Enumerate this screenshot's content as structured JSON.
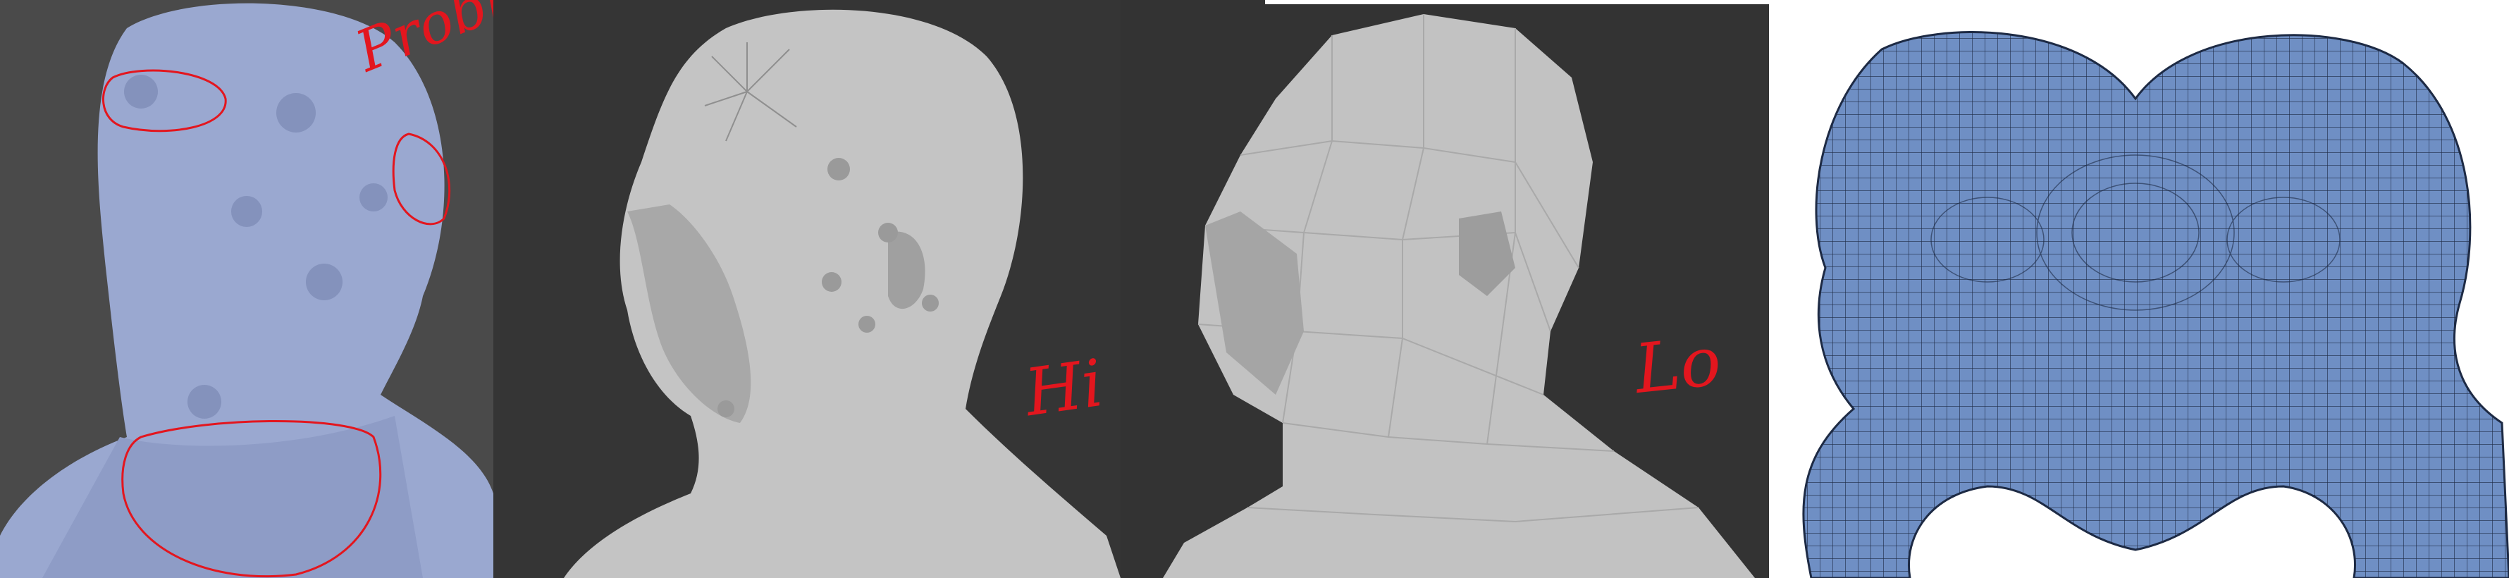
{
  "annotations": {
    "problem": "Problem",
    "hi": "Hi",
    "lo": "Lo"
  },
  "panels": {
    "baked": {
      "kind": "baked-normal-map-preview",
      "mesh_color": "#9aa8d0"
    },
    "hi": {
      "kind": "high-poly-sculpt",
      "mesh_color": "#bdbdbd"
    },
    "lo": {
      "kind": "low-poly-mesh",
      "mesh_color": "#c2c2c2"
    },
    "uv": {
      "kind": "uv-layout",
      "shell_color": "#6f8fc4",
      "wire_color": "#1d2a44"
    }
  },
  "colors": {
    "annotation_red": "#e3161e",
    "viewport_bg": "#333333"
  }
}
